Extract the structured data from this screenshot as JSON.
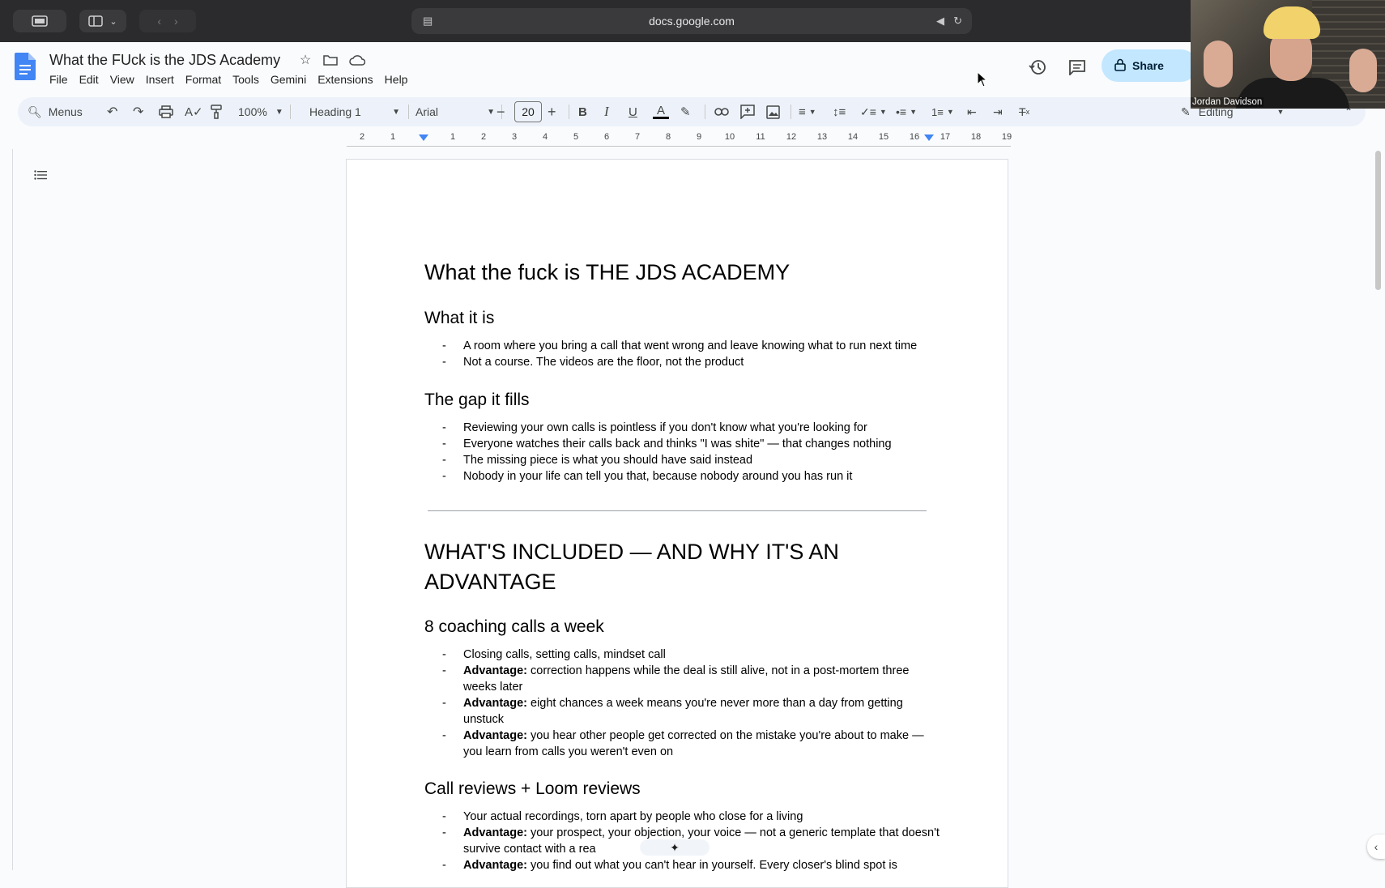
{
  "browser": {
    "url": "docs.google.com"
  },
  "doc": {
    "title": "What the FUck is the JDS Academy",
    "menus": [
      "File",
      "Edit",
      "View",
      "Insert",
      "Format",
      "Tools",
      "Gemini",
      "Extensions",
      "Help"
    ],
    "share_label": "Share",
    "mode_label": "Editing"
  },
  "toolbar": {
    "search_label": "Menus",
    "zoom": "100%",
    "style": "Heading 1",
    "font": "Arial",
    "font_size": "20"
  },
  "ruler": {
    "ticks": [
      "2",
      "1",
      "1",
      "2",
      "3",
      "4",
      "5",
      "6",
      "7",
      "8",
      "9",
      "10",
      "11",
      "12",
      "13",
      "14",
      "15",
      "16",
      "17",
      "18",
      "19"
    ]
  },
  "video": {
    "participant_name": "Jordan Davidson"
  },
  "content": {
    "title": "What the fuck is THE JDS ACADEMY",
    "s1_heading": "What it is",
    "s1_items": [
      "A room where you bring a call that went wrong and leave knowing what to run next time",
      "Not a course. The videos are the floor, not the product"
    ],
    "s2_heading": "The gap it fills",
    "s2_items": [
      "Reviewing your own calls is pointless if you don't know what you're looking for",
      "Everyone watches their calls back and thinks \"I was shite\" — that changes nothing",
      "The missing piece is what you should have said instead",
      "Nobody in your life can tell you that, because nobody around you has run it"
    ],
    "big_heading": "WHAT'S INCLUDED — AND WHY IT'S AN ADVANTAGE",
    "s3_heading": "8 coaching calls a week",
    "s3_item1": "Closing calls, setting calls, mindset call",
    "adv_label": "Advantage:",
    "s3_adv": [
      "correction happens while the deal is still alive, not in a post-mortem three weeks later",
      "eight chances a week means you're never more than a day from getting unstuck",
      "you hear other people get corrected on the mistake you're about to make — you learn from calls you weren't even on"
    ],
    "s4_heading": "Call reviews + Loom reviews",
    "s4_item1": "Your actual recordings, torn apart by people who close for a living",
    "s4_adv": [
      "your prospect, your objection, your voice — not a generic template that doesn't survive contact with a rea",
      "you find out what you can't hear in yourself. Every closer's blind spot is"
    ],
    "dash": "-"
  },
  "icons": {
    "ai_sparkle": "sparkle-icon"
  }
}
